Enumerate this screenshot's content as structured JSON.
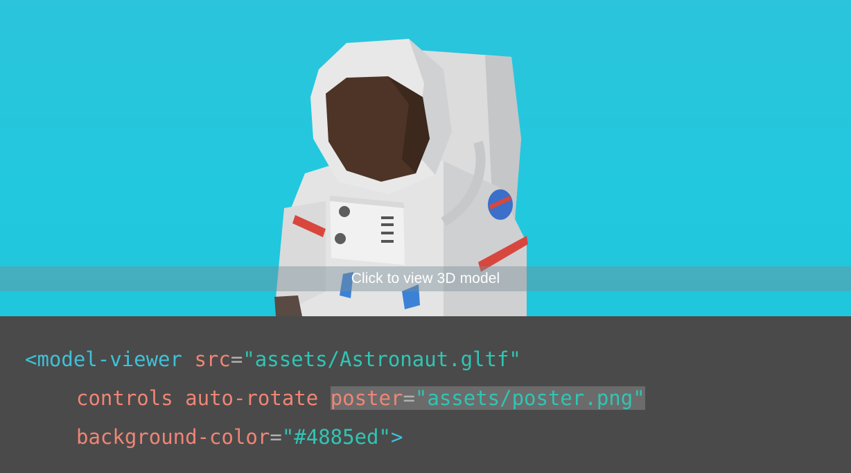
{
  "viewer": {
    "poster_label": "Click to view 3D model",
    "background": "#22c8de"
  },
  "code": {
    "line1": {
      "open": "<model-viewer",
      "attr_src": "src",
      "eq": "=",
      "val_src": "\"assets/Astronaut.gltf\""
    },
    "line2": {
      "attr_controls": "controls",
      "attr_autorotate": "auto-rotate",
      "attr_poster": "poster",
      "eq": "=",
      "val_poster": "\"assets/poster.png\""
    },
    "line3": {
      "attr_bg": "background-color",
      "eq": "=",
      "val_bg": "\"#4885ed\"",
      "close": ">"
    }
  },
  "colors": {
    "tag": "#3fc1d8",
    "attribute": "#f08575",
    "string": "#30c5b4",
    "code_background": "#4a4a4a"
  }
}
